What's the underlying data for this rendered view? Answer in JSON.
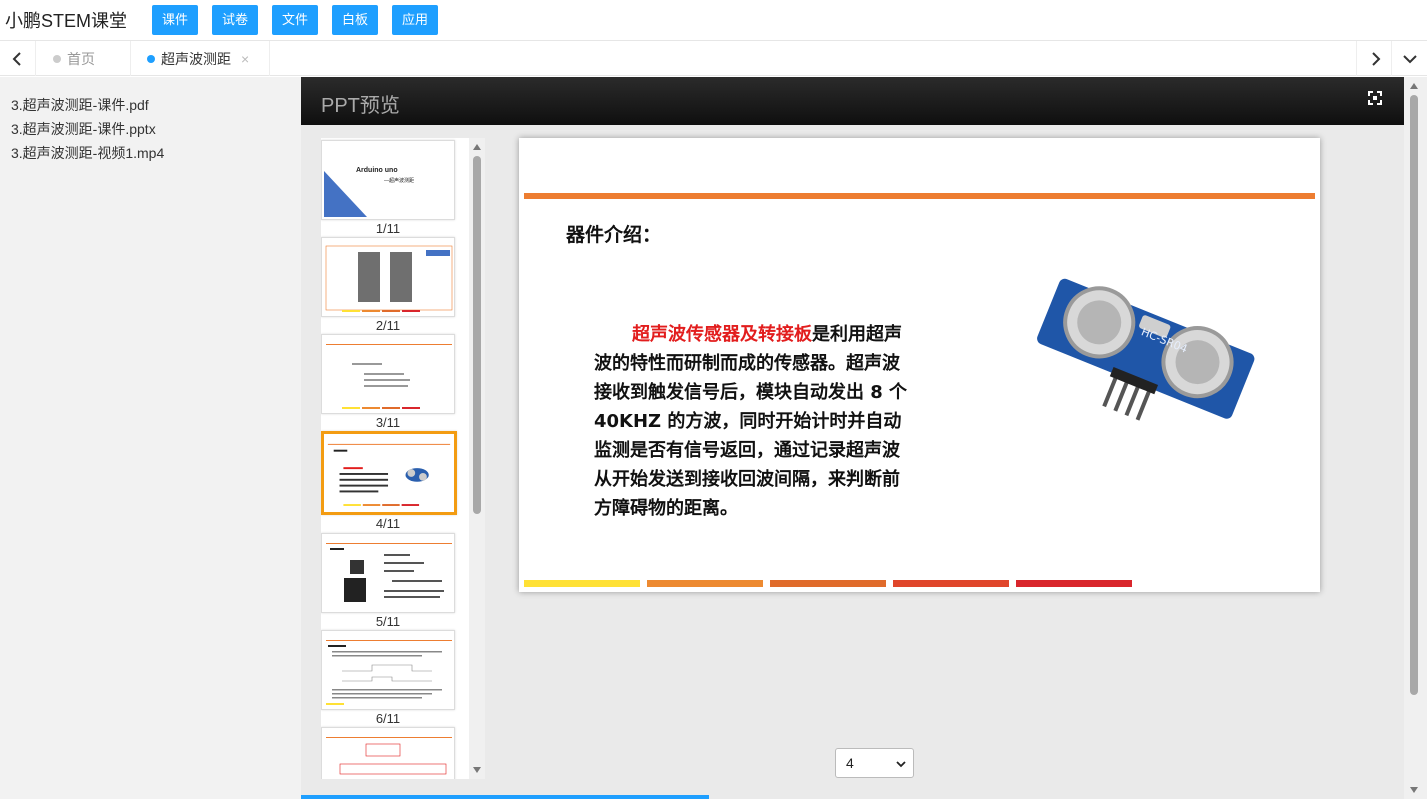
{
  "app": {
    "title": "小鹏STEM课堂"
  },
  "toolbar": {
    "buttons": [
      {
        "label": "课件"
      },
      {
        "label": "试卷"
      },
      {
        "label": "文件"
      },
      {
        "label": "白板"
      },
      {
        "label": "应用"
      }
    ]
  },
  "tabs": [
    {
      "label": "首页",
      "active": false
    },
    {
      "label": "超声波测距",
      "active": true,
      "close": "×"
    }
  ],
  "files": [
    "3.超声波测距-课件.pdf",
    "3.超声波测距-课件.pptx",
    "3.超声波测距-视频1.mp4"
  ],
  "viewer": {
    "title": "PPT预览",
    "thumbnails": [
      {
        "label": "1/11",
        "title": "Arduino uno",
        "subtitle": "—超声波测距"
      },
      {
        "label": "2/11"
      },
      {
        "label": "3/11"
      },
      {
        "label": "4/11",
        "active": true
      },
      {
        "label": "5/11"
      },
      {
        "label": "6/11"
      },
      {
        "label": ""
      }
    ],
    "slide": {
      "heading": "器件介绍：",
      "body_highlight": "超声波传感器及转接板",
      "body_rest": "是利用超声波的特性而研制而成的传感器。超声波接收到触发信号后，模块自动发出 8 个 40KHZ 的方波，同时开始计时并自动监测是否有信号返回，通过记录超声波从开始发送到接收回波间隔，来判断前方障碍物的距离。",
      "module_label": "HC-SR04"
    },
    "page_select": "4",
    "load_progress": 0.37
  },
  "colors": {
    "primary": "#1e9fff",
    "active_border": "#f39c12",
    "slide_orange": "#ed7d31",
    "highlight_red": "#e21d1d",
    "bars": [
      "#ffe135",
      "#ed8a31",
      "#e06b2b",
      "#e0462b",
      "#d9262c"
    ]
  }
}
